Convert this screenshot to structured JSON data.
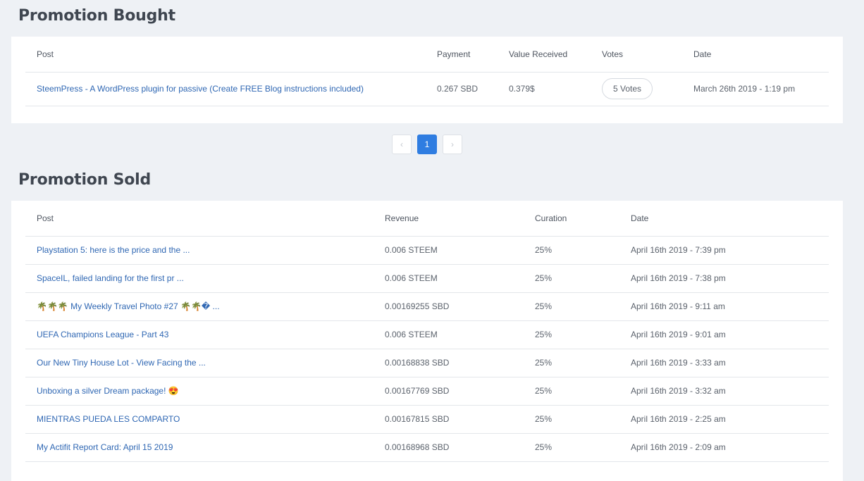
{
  "bought": {
    "title": "Promotion Bought",
    "columns": [
      "Post",
      "Payment",
      "Value Received",
      "Votes",
      "Date"
    ],
    "rows": [
      {
        "post": "SteemPress - A WordPress plugin for passive (Create FREE Blog instructions included)",
        "payment": "0.267 SBD",
        "value": "0.379$",
        "votes": "5 Votes",
        "date": "March 26th 2019 - 1:19 pm"
      }
    ]
  },
  "pagination": {
    "prev": "‹",
    "current": "1",
    "next": "›"
  },
  "sold": {
    "title": "Promotion Sold",
    "columns": [
      "Post",
      "Revenue",
      "Curation",
      "Date"
    ],
    "rows": [
      {
        "post": "Playstation 5: here is the price and the ...",
        "revenue": "0.006 STEEM",
        "curation": "25%",
        "date": "April 16th 2019 - 7:39 pm"
      },
      {
        "post": "SpaceIL, failed landing for the first pr ...",
        "revenue": "0.006 STEEM",
        "curation": "25%",
        "date": "April 16th 2019 - 7:38 pm"
      },
      {
        "post": "🌴🌴🌴 My Weekly Travel Photo #27 🌴🌴� ...",
        "revenue": "0.00169255 SBD",
        "curation": "25%",
        "date": "April 16th 2019 - 9:11 am"
      },
      {
        "post": "UEFA Champions League - Part 43",
        "revenue": "0.006 STEEM",
        "curation": "25%",
        "date": "April 16th 2019 - 9:01 am"
      },
      {
        "post": "Our New Tiny House Lot - View Facing the ...",
        "revenue": "0.00168838 SBD",
        "curation": "25%",
        "date": "April 16th 2019 - 3:33 am"
      },
      {
        "post": "Unboxing a silver Dream package! 😍",
        "revenue": "0.00167769 SBD",
        "curation": "25%",
        "date": "April 16th 2019 - 3:32 am"
      },
      {
        "post": "MIENTRAS PUEDA LES COMPARTO",
        "revenue": "0.00167815 SBD",
        "curation": "25%",
        "date": "April 16th 2019 - 2:25 am"
      },
      {
        "post": "My Actifit Report Card: April 15 2019",
        "revenue": "0.00168968 SBD",
        "curation": "25%",
        "date": "April 16th 2019 - 2:09 am"
      }
    ]
  }
}
